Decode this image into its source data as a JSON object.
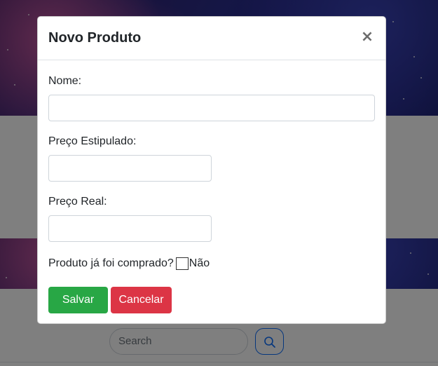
{
  "background": {
    "search": {
      "placeholder": "Search"
    },
    "icons": {
      "search_button": "search-icon"
    }
  },
  "modal": {
    "title": "Novo Produto",
    "close_label": "×",
    "fields": {
      "nome": {
        "label": "Nome:",
        "value": ""
      },
      "preco_estipulado": {
        "label": "Preço Estipulado:",
        "value": ""
      },
      "preco_real": {
        "label": "Preço Real:",
        "value": ""
      }
    },
    "comprado": {
      "label": "Produto já foi comprado?",
      "checkbox_label": "Não",
      "checked": false
    },
    "buttons": {
      "save": "Salvar",
      "cancel": "Cancelar"
    }
  },
  "colors": {
    "save": "#28a745",
    "cancel": "#dc3545",
    "search_button_border": "#0d6efd"
  }
}
